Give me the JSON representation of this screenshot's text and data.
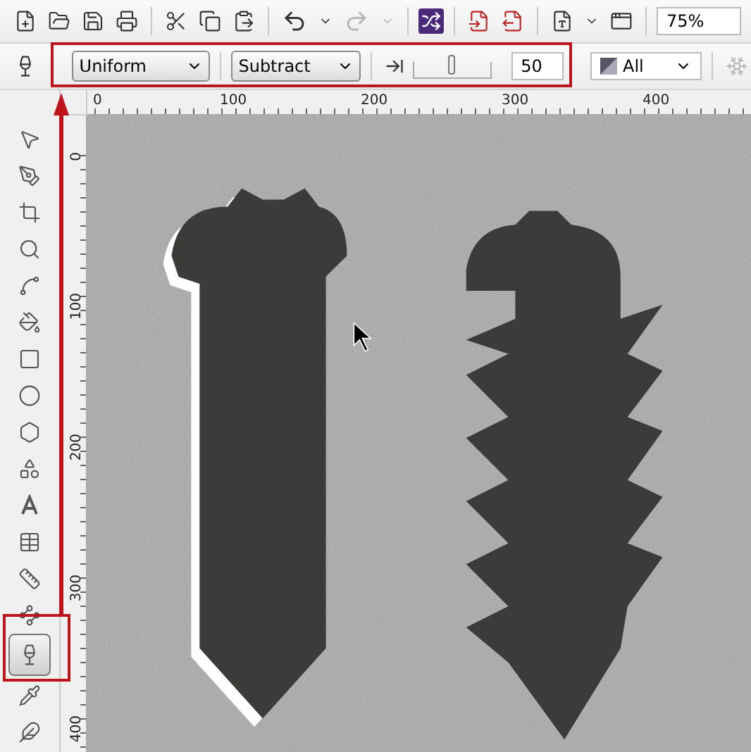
{
  "toolbar": {
    "redo": {
      "disabled": true
    },
    "zoom": "75%"
  },
  "property_bar": {
    "fill_type": "Uniform",
    "merge_mode": "Subtract",
    "transparency": {
      "level": 0.5,
      "value": "50"
    },
    "target": "All"
  },
  "rulers": {
    "horizontal": [
      "0",
      "100",
      "200",
      "300",
      "400"
    ],
    "vertical": [
      "0",
      "100",
      "200",
      "300",
      "400"
    ]
  },
  "tools": [
    {
      "selected": false
    },
    {
      "selected": false
    },
    {
      "selected": false
    },
    {
      "selected": false
    },
    {
      "selected": false
    },
    {
      "selected": false
    },
    {
      "selected": false
    },
    {
      "selected": false
    },
    {
      "selected": false
    },
    {
      "selected": false
    },
    {
      "selected": false
    },
    {
      "selected": false
    },
    {
      "selected": false
    },
    {
      "selected": false
    },
    {
      "selected": true
    },
    {
      "selected": false
    },
    {
      "selected": false
    }
  ]
}
